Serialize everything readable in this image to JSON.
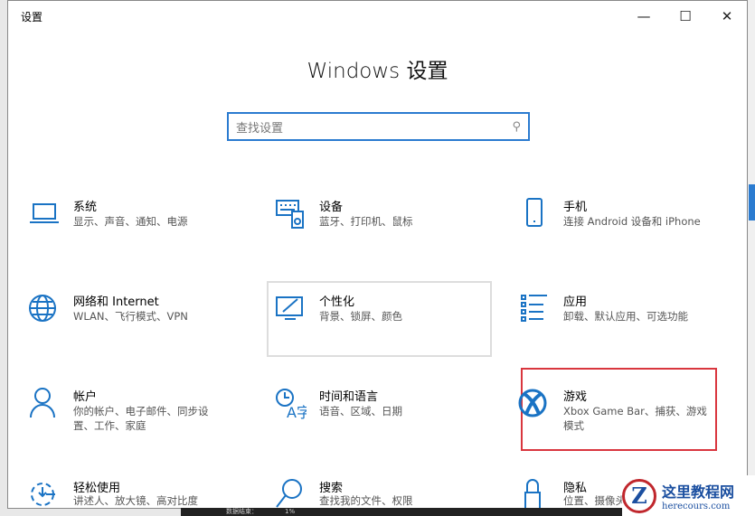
{
  "window": {
    "title": "设置",
    "minimize": "—",
    "maximize": "☐",
    "close": "✕"
  },
  "heading": "Windows 设置",
  "search": {
    "placeholder": "查找设置"
  },
  "items": [
    {
      "title": "系统",
      "subtitle": "显示、声音、通知、电源",
      "icon": "laptop-icon"
    },
    {
      "title": "设备",
      "subtitle": "蓝牙、打印机、鼠标",
      "icon": "keyboard-icon"
    },
    {
      "title": "手机",
      "subtitle": "连接 Android 设备和 iPhone",
      "icon": "phone-icon"
    },
    {
      "title": "网络和 Internet",
      "subtitle": "WLAN、飞行模式、VPN",
      "icon": "globe-icon"
    },
    {
      "title": "个性化",
      "subtitle": "背景、锁屏、颜色",
      "icon": "personalize-icon"
    },
    {
      "title": "应用",
      "subtitle": "卸载、默认应用、可选功能",
      "icon": "apps-list-icon"
    },
    {
      "title": "帐户",
      "subtitle": "你的帐户、电子邮件、同步设置、工作、家庭",
      "icon": "person-icon"
    },
    {
      "title": "时间和语言",
      "subtitle": "语音、区域、日期",
      "icon": "time-language-icon"
    },
    {
      "title": "游戏",
      "subtitle": "Xbox Game Bar、捕获、游戏模式",
      "icon": "xbox-icon"
    },
    {
      "title": "轻松使用",
      "subtitle": "讲述人、放大镜、高对比度",
      "icon": "ease-of-access-icon"
    },
    {
      "title": "搜索",
      "subtitle": "查找我的文件、权限",
      "icon": "search-icon"
    },
    {
      "title": "隐私",
      "subtitle": "位置、摄像头",
      "icon": "lock-icon"
    }
  ],
  "strip": {
    "text": "数据结束：",
    "value": "1%"
  },
  "watermark": {
    "name": "这里教程网",
    "url": "herecours.com",
    "letter": "Z"
  },
  "colors": {
    "accent": "#1a73c4",
    "highlight": "#d9363e"
  }
}
